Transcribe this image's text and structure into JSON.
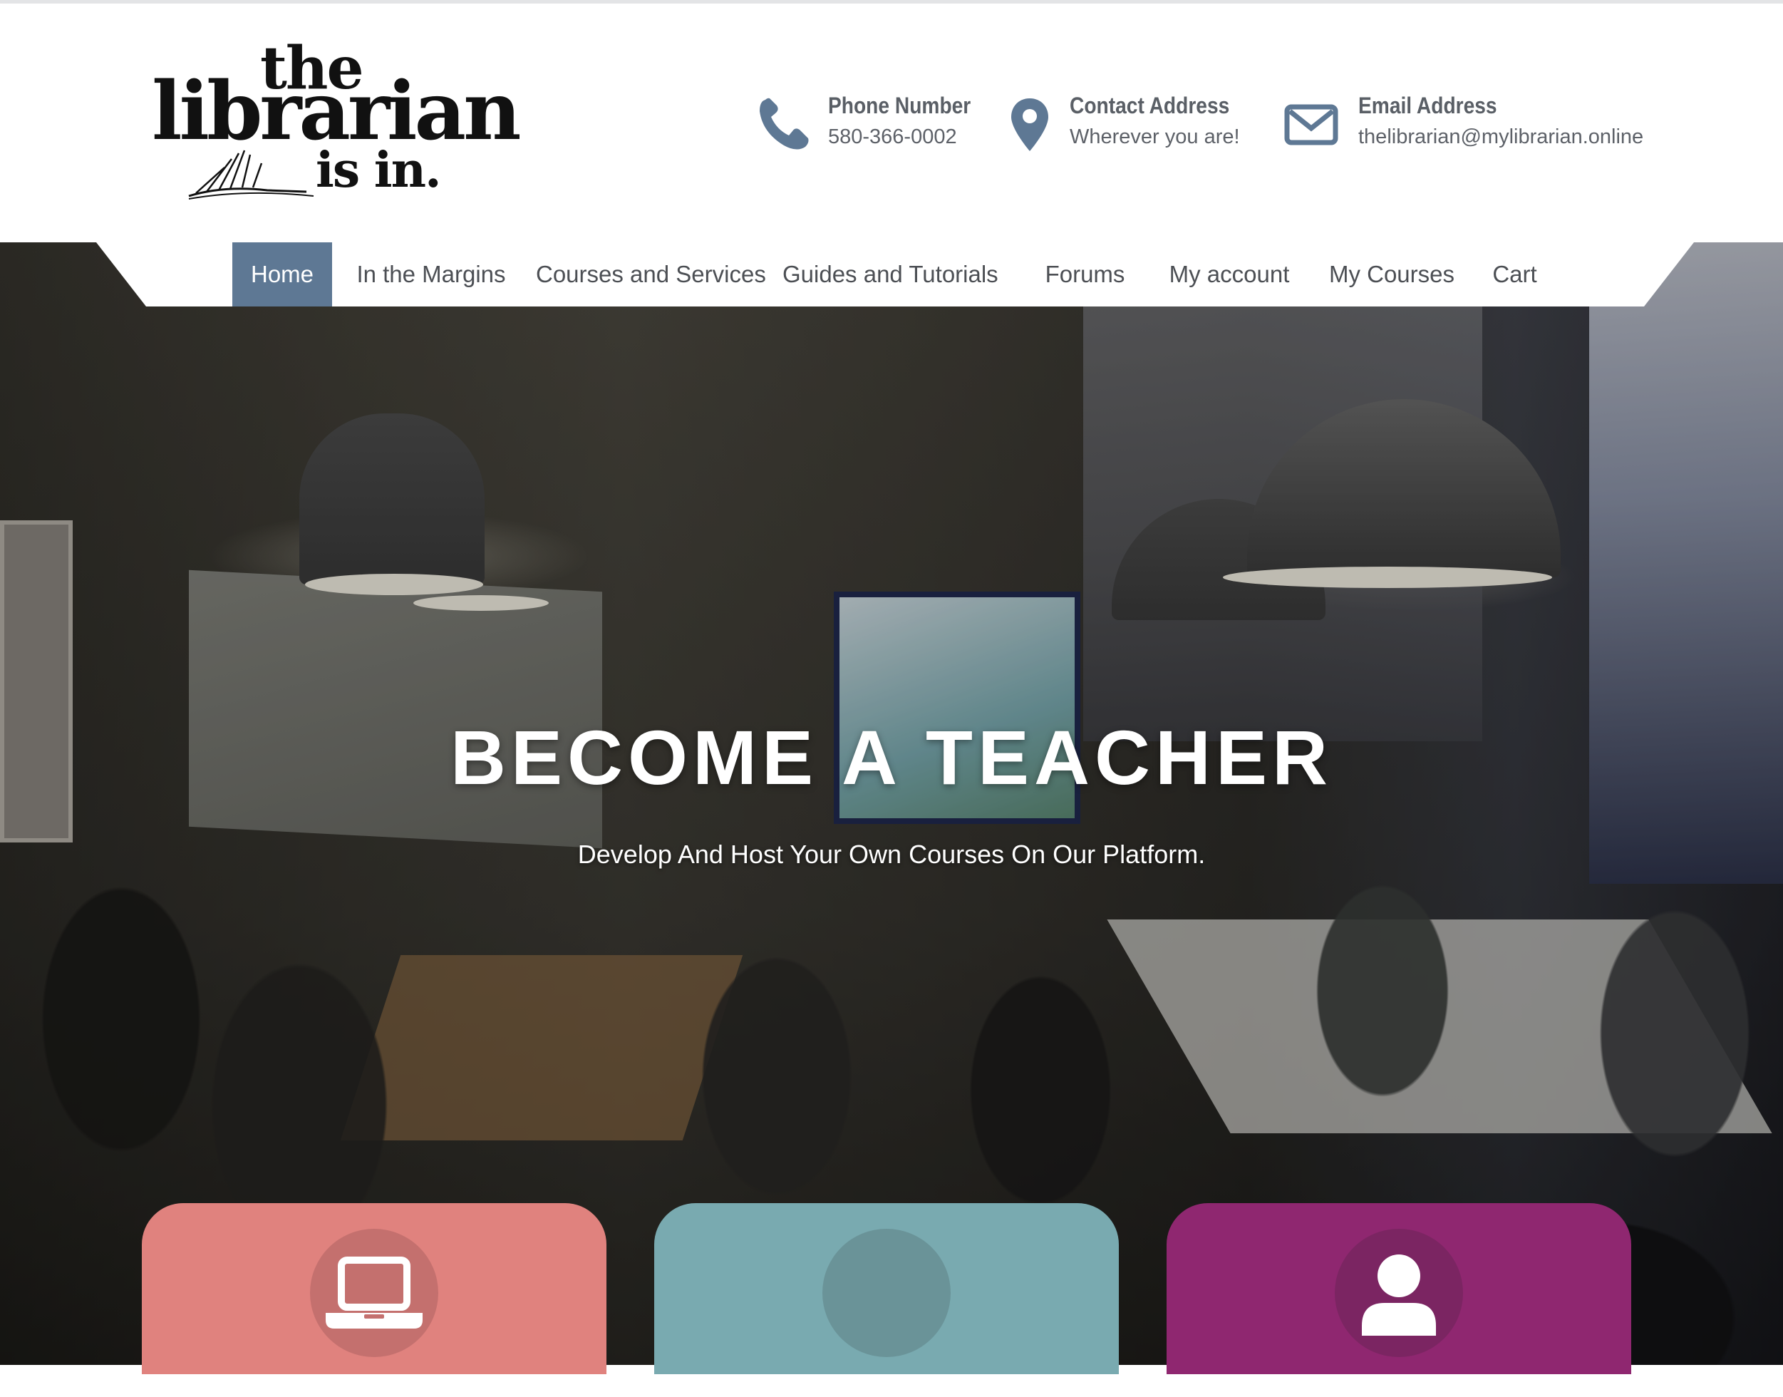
{
  "site": {
    "logo": {
      "line1": "the",
      "line2": "librarian",
      "line3": "is in."
    },
    "contacts": [
      {
        "icon": "phone-icon",
        "label": "Phone Number",
        "value": "580-366-0002"
      },
      {
        "icon": "map-pin-icon",
        "label": "Contact Address",
        "value": "Wherever you are!"
      },
      {
        "icon": "envelope-icon",
        "label": "Email Address",
        "value": "thelibrarian@mylibrarian.online"
      }
    ]
  },
  "nav": {
    "active": "Home",
    "items": [
      {
        "label": "Home"
      },
      {
        "label": "In the Margins"
      },
      {
        "label": "Courses and Services"
      },
      {
        "label": "Guides and Tutorials"
      },
      {
        "label": "Forums"
      },
      {
        "label": "My account"
      },
      {
        "label": "My Courses"
      },
      {
        "label": "Cart"
      }
    ]
  },
  "hero": {
    "title": "BECOME A TEACHER",
    "subtitle": "Develop And Host Your Own Courses On Our Platform."
  },
  "cards": [
    {
      "icon": "laptop-icon",
      "color": "#e0827e"
    },
    {
      "icon": "",
      "color": "#79aab0"
    },
    {
      "icon": "user-icon",
      "color": "#8f2770"
    }
  ],
  "colors": {
    "nav_active": "#5e7894",
    "contact_icon": "#5e7894",
    "text_gray": "#5a5f66"
  }
}
